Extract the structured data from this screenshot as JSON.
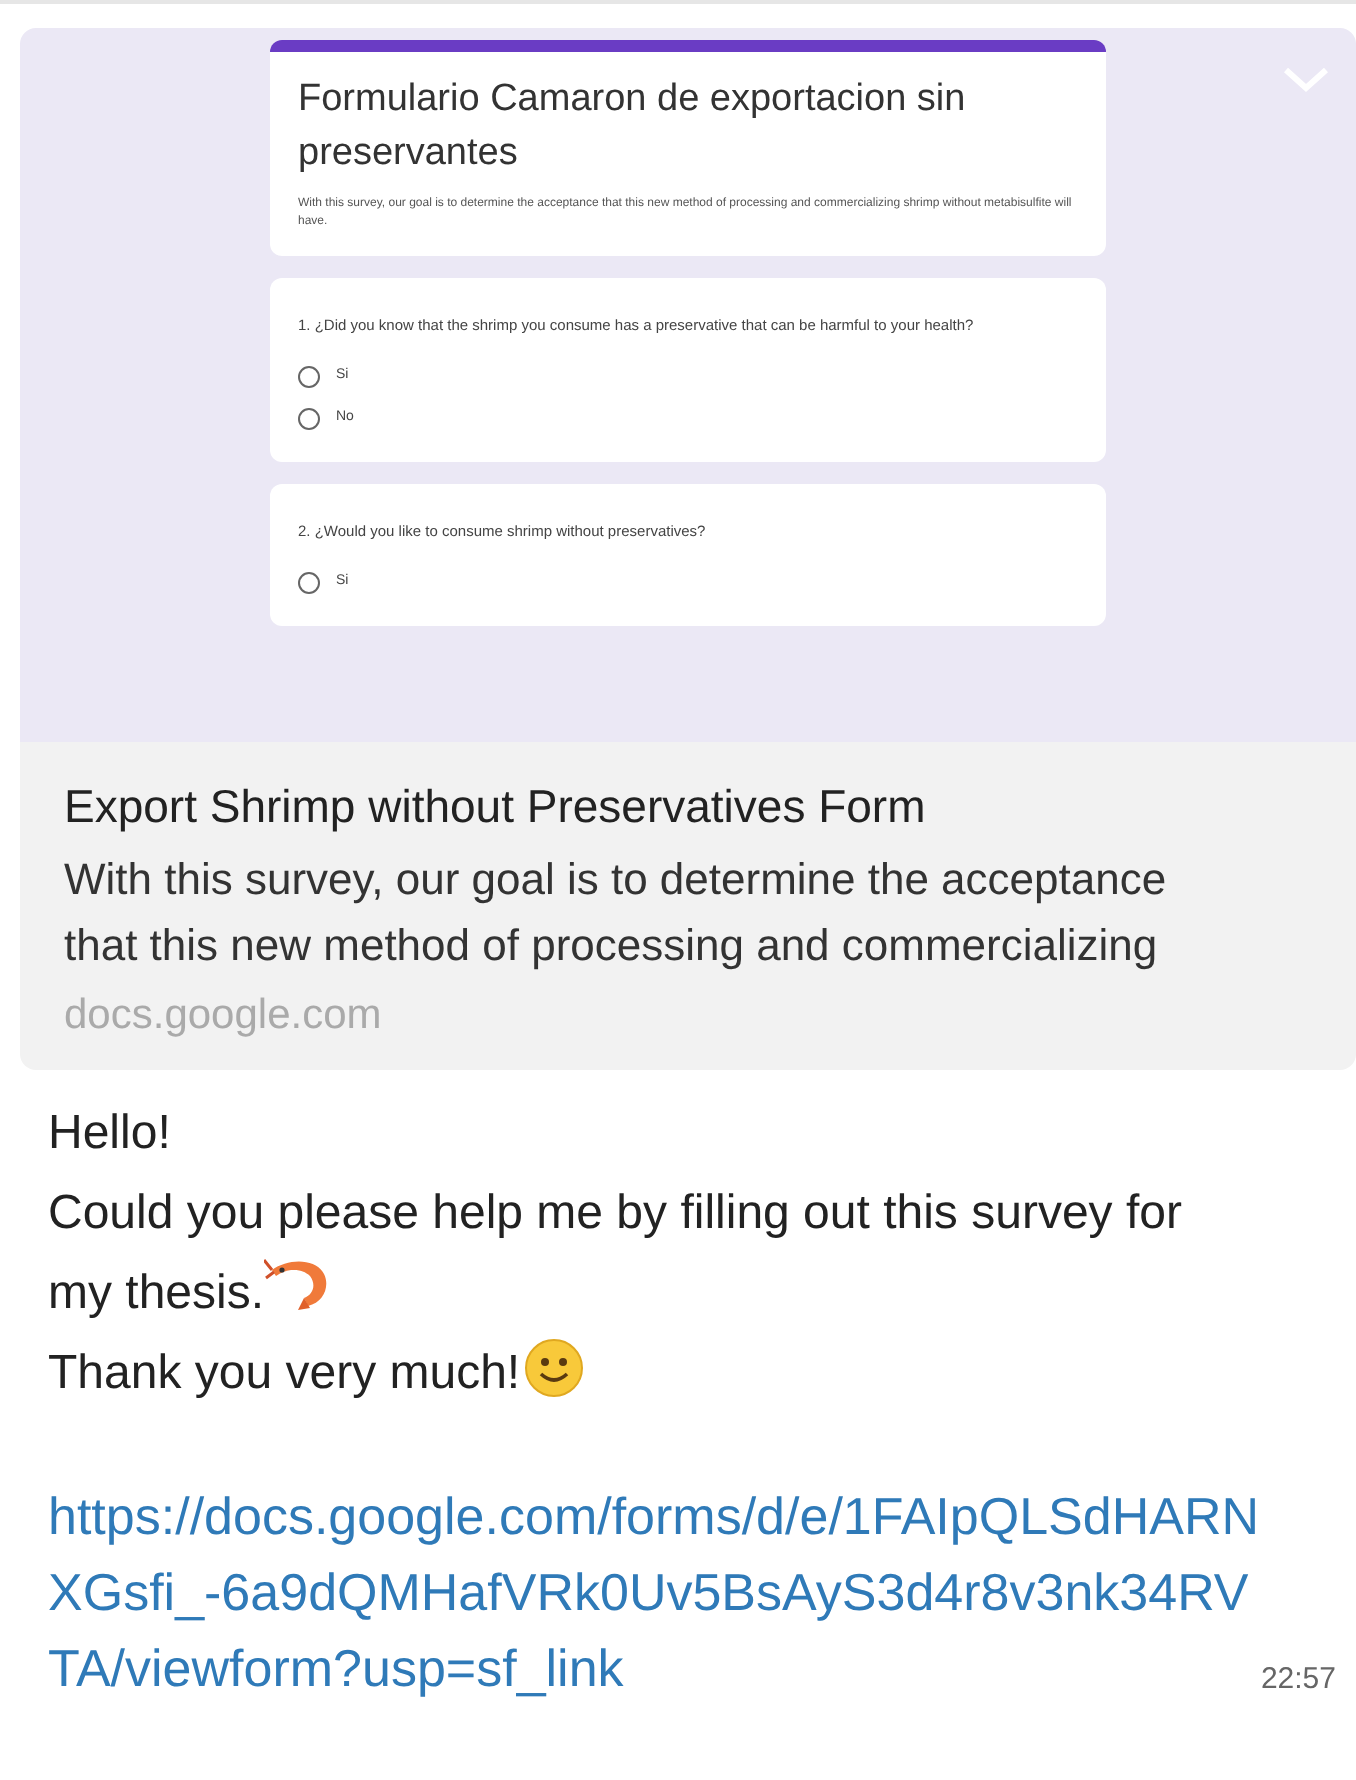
{
  "preview": {
    "form_title": "Formulario Camaron de exportacion sin preservantes",
    "form_description": "With this survey, our goal is to determine the acceptance that this new method of processing and commercializing shrimp without metabisulfite will have.",
    "questions": [
      {
        "text": "1.  ¿Did you know that the shrimp you consume has a preservative that can be harmful to your health?",
        "options": [
          {
            "label": "Si",
            "selected": false
          },
          {
            "label": "No",
            "selected": false
          }
        ]
      },
      {
        "text": "2.  ¿Would you like to consume shrimp without preservatives?",
        "options": [
          {
            "label": "Si",
            "selected": false
          }
        ]
      }
    ]
  },
  "link_card": {
    "title": "Export Shrimp without Preservatives Form",
    "description": "With this survey, our goal is to determine the acceptance that this new method of processing and commercializing",
    "domain": "docs.google.com"
  },
  "message": {
    "lines": [
      {
        "text": "Hello!",
        "kind": "plain"
      },
      {
        "text": "Could you please help me by filling out this survey for my thesis.",
        "kind": "shrimp"
      },
      {
        "text": "Thank you very much!",
        "kind": "smile"
      }
    ],
    "link": "https://docs.google.com/forms/d/e/1FAIpQLSdHARNXGsfi_-6a9dQMHafVRk0Uv5BsAyS3d4r8v3nk34RVTA/viewform?usp=sf_link",
    "time": "22:57"
  }
}
